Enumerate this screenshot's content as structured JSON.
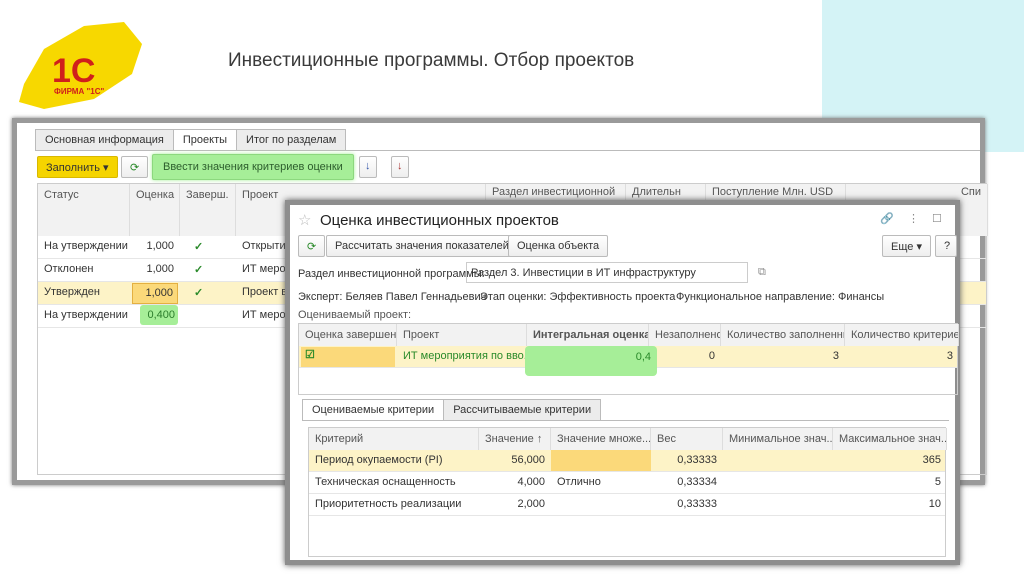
{
  "slide": {
    "title": "Инвестиционные программы. Отбор проектов",
    "logo_text": "1С",
    "logo_caption": "ФИРМА \"1С\""
  },
  "main": {
    "tabs": [
      "Основная информация",
      "Проекты",
      "Итог по разделам"
    ],
    "fill_button": "Заполнить ▾",
    "enter_criteria_button": "Ввести значения критериев оценки",
    "columns": [
      "Статус",
      "Оценка",
      "Заверш.",
      "Проект",
      "Раздел инвестиционной",
      "Длительн",
      "Поступление Млн. USD",
      "Спи"
    ],
    "rows": [
      {
        "status": "На утверждении",
        "score": "1,000",
        "done": "✓",
        "project": "Открытие"
      },
      {
        "status": "Отклонен",
        "score": "1,000",
        "done": "✓",
        "project": "ИТ мероп"
      },
      {
        "status": "Утвержден",
        "score": "1,000",
        "done": "✓",
        "project": "Проект вн"
      },
      {
        "status": "На утверждении",
        "score": "0,400",
        "done": "",
        "project": "ИТ мероп"
      }
    ]
  },
  "dialog": {
    "title": "Оценка инвестиционных проектов",
    "calc_button": "Рассчитать значения показателей",
    "evaluate_button": "Оценка объекта",
    "more_button": "Еще ▾",
    "help_button": "?",
    "section_label": "Раздел инвестиционной программы:",
    "section_value": "Раздел 3. Инвестиции в ИТ инфраструктуру",
    "expert": "Эксперт: Беляев Павел Геннадьевич",
    "stage": "Этап оценки: Эффективность проекта",
    "direction": "Функциональное направление: Финансы",
    "project_label": "Оцениваемый проект:",
    "project_columns": [
      "Оценка завершена",
      "Проект",
      "Интегральная оценка",
      "Незаполнено",
      "Количество заполненных",
      "Количество критериев"
    ],
    "project_row": {
      "done": true,
      "project": "ИТ мероприятия по вво...",
      "integral": "0,4",
      "unfilled": "0",
      "filled": "3",
      "criteria": "3"
    },
    "tabs": [
      "Оцениваемые критерии",
      "Рассчитываемые критерии"
    ],
    "criteria_columns": [
      "Критерий",
      "Значение ↑",
      "Значение множе...",
      "Вес",
      "Минимальное знач...",
      "Максимальное знач..."
    ],
    "criteria_rows": [
      {
        "name": "Период окупаемости (PI)",
        "value": "56,000",
        "set": "",
        "weight": "0,33333",
        "min": "",
        "max": "365"
      },
      {
        "name": "Техническая оснащенность",
        "value": "4,000",
        "set": "Отлично",
        "weight": "0,33334",
        "min": "",
        "max": "5"
      },
      {
        "name": "Приоритетность реализации",
        "value": "2,000",
        "set": "",
        "weight": "0,33333",
        "min": "",
        "max": "10"
      }
    ]
  },
  "colors": {
    "accent_yellow": "#f5d400",
    "highlight_green": "#9ef08a",
    "selected_row": "#fdf3c7"
  }
}
